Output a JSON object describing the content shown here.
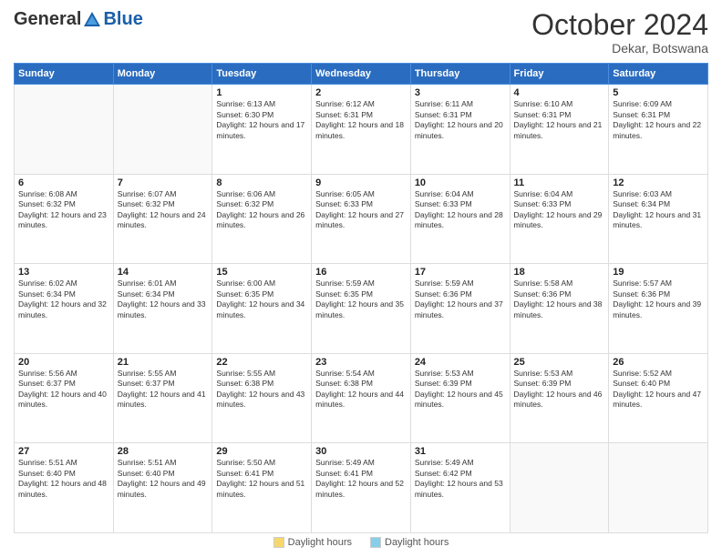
{
  "header": {
    "logo": {
      "general": "General",
      "blue": "Blue"
    },
    "title": "October 2024",
    "location": "Dekar, Botswana"
  },
  "weekdays": [
    "Sunday",
    "Monday",
    "Tuesday",
    "Wednesday",
    "Thursday",
    "Friday",
    "Saturday"
  ],
  "weeks": [
    [
      {
        "day": "",
        "info": ""
      },
      {
        "day": "",
        "info": ""
      },
      {
        "day": "1",
        "info": "Sunrise: 6:13 AM\nSunset: 6:30 PM\nDaylight: 12 hours and 17 minutes."
      },
      {
        "day": "2",
        "info": "Sunrise: 6:12 AM\nSunset: 6:31 PM\nDaylight: 12 hours and 18 minutes."
      },
      {
        "day": "3",
        "info": "Sunrise: 6:11 AM\nSunset: 6:31 PM\nDaylight: 12 hours and 20 minutes."
      },
      {
        "day": "4",
        "info": "Sunrise: 6:10 AM\nSunset: 6:31 PM\nDaylight: 12 hours and 21 minutes."
      },
      {
        "day": "5",
        "info": "Sunrise: 6:09 AM\nSunset: 6:31 PM\nDaylight: 12 hours and 22 minutes."
      }
    ],
    [
      {
        "day": "6",
        "info": "Sunrise: 6:08 AM\nSunset: 6:32 PM\nDaylight: 12 hours and 23 minutes."
      },
      {
        "day": "7",
        "info": "Sunrise: 6:07 AM\nSunset: 6:32 PM\nDaylight: 12 hours and 24 minutes."
      },
      {
        "day": "8",
        "info": "Sunrise: 6:06 AM\nSunset: 6:32 PM\nDaylight: 12 hours and 26 minutes."
      },
      {
        "day": "9",
        "info": "Sunrise: 6:05 AM\nSunset: 6:33 PM\nDaylight: 12 hours and 27 minutes."
      },
      {
        "day": "10",
        "info": "Sunrise: 6:04 AM\nSunset: 6:33 PM\nDaylight: 12 hours and 28 minutes."
      },
      {
        "day": "11",
        "info": "Sunrise: 6:04 AM\nSunset: 6:33 PM\nDaylight: 12 hours and 29 minutes."
      },
      {
        "day": "12",
        "info": "Sunrise: 6:03 AM\nSunset: 6:34 PM\nDaylight: 12 hours and 31 minutes."
      }
    ],
    [
      {
        "day": "13",
        "info": "Sunrise: 6:02 AM\nSunset: 6:34 PM\nDaylight: 12 hours and 32 minutes."
      },
      {
        "day": "14",
        "info": "Sunrise: 6:01 AM\nSunset: 6:34 PM\nDaylight: 12 hours and 33 minutes."
      },
      {
        "day": "15",
        "info": "Sunrise: 6:00 AM\nSunset: 6:35 PM\nDaylight: 12 hours and 34 minutes."
      },
      {
        "day": "16",
        "info": "Sunrise: 5:59 AM\nSunset: 6:35 PM\nDaylight: 12 hours and 35 minutes."
      },
      {
        "day": "17",
        "info": "Sunrise: 5:59 AM\nSunset: 6:36 PM\nDaylight: 12 hours and 37 minutes."
      },
      {
        "day": "18",
        "info": "Sunrise: 5:58 AM\nSunset: 6:36 PM\nDaylight: 12 hours and 38 minutes."
      },
      {
        "day": "19",
        "info": "Sunrise: 5:57 AM\nSunset: 6:36 PM\nDaylight: 12 hours and 39 minutes."
      }
    ],
    [
      {
        "day": "20",
        "info": "Sunrise: 5:56 AM\nSunset: 6:37 PM\nDaylight: 12 hours and 40 minutes."
      },
      {
        "day": "21",
        "info": "Sunrise: 5:55 AM\nSunset: 6:37 PM\nDaylight: 12 hours and 41 minutes."
      },
      {
        "day": "22",
        "info": "Sunrise: 5:55 AM\nSunset: 6:38 PM\nDaylight: 12 hours and 43 minutes."
      },
      {
        "day": "23",
        "info": "Sunrise: 5:54 AM\nSunset: 6:38 PM\nDaylight: 12 hours and 44 minutes."
      },
      {
        "day": "24",
        "info": "Sunrise: 5:53 AM\nSunset: 6:39 PM\nDaylight: 12 hours and 45 minutes."
      },
      {
        "day": "25",
        "info": "Sunrise: 5:53 AM\nSunset: 6:39 PM\nDaylight: 12 hours and 46 minutes."
      },
      {
        "day": "26",
        "info": "Sunrise: 5:52 AM\nSunset: 6:40 PM\nDaylight: 12 hours and 47 minutes."
      }
    ],
    [
      {
        "day": "27",
        "info": "Sunrise: 5:51 AM\nSunset: 6:40 PM\nDaylight: 12 hours and 48 minutes."
      },
      {
        "day": "28",
        "info": "Sunrise: 5:51 AM\nSunset: 6:40 PM\nDaylight: 12 hours and 49 minutes."
      },
      {
        "day": "29",
        "info": "Sunrise: 5:50 AM\nSunset: 6:41 PM\nDaylight: 12 hours and 51 minutes."
      },
      {
        "day": "30",
        "info": "Sunrise: 5:49 AM\nSunset: 6:41 PM\nDaylight: 12 hours and 52 minutes."
      },
      {
        "day": "31",
        "info": "Sunrise: 5:49 AM\nSunset: 6:42 PM\nDaylight: 12 hours and 53 minutes."
      },
      {
        "day": "",
        "info": ""
      },
      {
        "day": "",
        "info": ""
      }
    ]
  ],
  "footer": {
    "legend1_label": "Daylight hours",
    "legend1_color": "#f0e68c",
    "legend2_label": "Daylight hours",
    "legend2_color": "#87ceeb"
  }
}
